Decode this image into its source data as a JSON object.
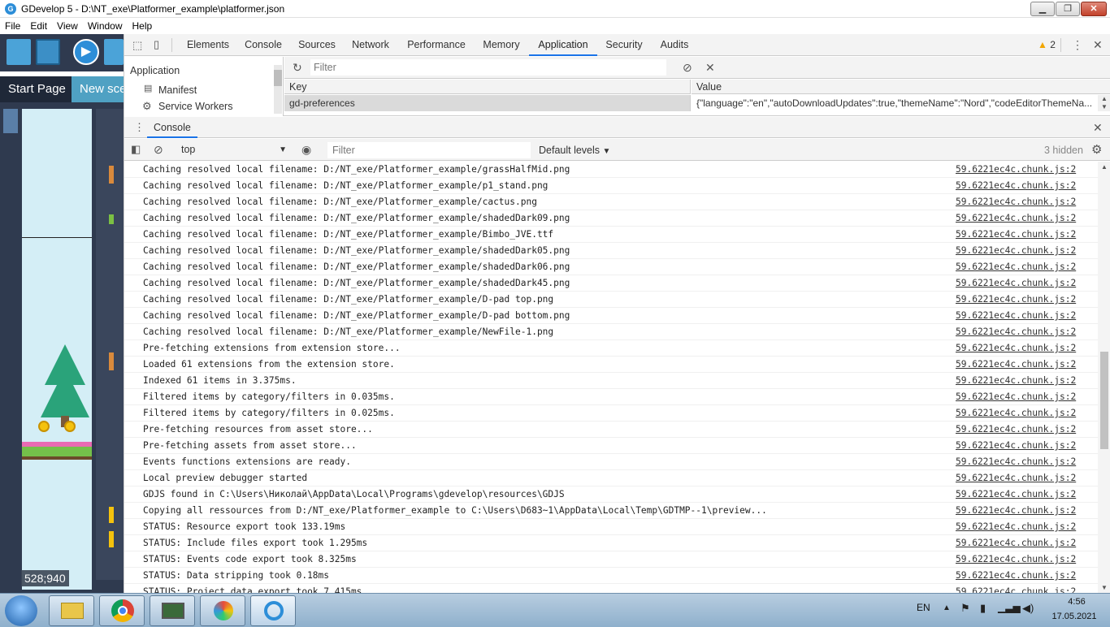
{
  "window": {
    "title": "GDevelop 5 - D:\\NT_exe\\Platformer_example\\platformer.json",
    "icon": "gdevelop-logo-icon"
  },
  "menu": [
    "File",
    "Edit",
    "View",
    "Window",
    "Help"
  ],
  "gdevelop": {
    "tabs": {
      "start": "Start Page",
      "scene": "New sce"
    },
    "coords": "528;940"
  },
  "devtools": {
    "tabs": [
      "Elements",
      "Console",
      "Sources",
      "Network",
      "Performance",
      "Memory",
      "Application",
      "Security",
      "Audits"
    ],
    "active_tab": "Application",
    "warning_count": "2",
    "application": {
      "section": "Application",
      "items": [
        "Manifest",
        "Service Workers"
      ],
      "filter_placeholder": "Filter",
      "columns": {
        "key": "Key",
        "value": "Value"
      },
      "row": {
        "key": "gd-preferences",
        "value": "{\"language\":\"en\",\"autoDownloadUpdates\":true,\"themeName\":\"Nord\",\"codeEditorThemeNa..."
      }
    },
    "console": {
      "tab": "Console",
      "context": "top",
      "filter_placeholder": "Filter",
      "levels": "Default levels",
      "hidden": "3 hidden",
      "source": "59.6221ec4c.chunk.js:2",
      "lines": [
        "Caching resolved local filename: D:/NT_exe/Platformer_example/grassHalfMid.png",
        "Caching resolved local filename: D:/NT_exe/Platformer_example/p1_stand.png",
        "Caching resolved local filename: D:/NT_exe/Platformer_example/cactus.png",
        "Caching resolved local filename: D:/NT_exe/Platformer_example/shadedDark09.png",
        "Caching resolved local filename: D:/NT_exe/Platformer_example/Bimbo_JVE.ttf",
        "Caching resolved local filename: D:/NT_exe/Platformer_example/shadedDark05.png",
        "Caching resolved local filename: D:/NT_exe/Platformer_example/shadedDark06.png",
        "Caching resolved local filename: D:/NT_exe/Platformer_example/shadedDark45.png",
        "Caching resolved local filename: D:/NT_exe/Platformer_example/D-pad top.png",
        "Caching resolved local filename: D:/NT_exe/Platformer_example/D-pad bottom.png",
        "Caching resolved local filename: D:/NT_exe/Platformer_example/NewFile-1.png",
        "Pre-fetching extensions from extension store...",
        "Loaded 61 extensions from the extension store.",
        "Indexed 61 items in 3.375ms.",
        "Filtered items by category/filters in 0.035ms.",
        "Filtered items by category/filters in 0.025ms.",
        "Pre-fetching resources from asset store...",
        "Pre-fetching assets from asset store...",
        "Events functions extensions are ready.",
        "Local preview debugger started",
        "GDJS found in  C:\\Users\\Николай\\AppData\\Local\\Programs\\gdevelop\\resources\\GDJS",
        "Copying all ressources from D:/NT_exe/Platformer_example to C:\\Users\\D683~1\\AppData\\Local\\Temp\\GDTMP--1\\preview...",
        "STATUS: Resource export took 133.19ms",
        "STATUS: Include files export took 1.295ms",
        "STATUS: Events code export took 8.325ms",
        "STATUS: Data stripping took 0.18ms",
        "STATUS: Project data export took 7.415ms"
      ]
    }
  },
  "taskbar": {
    "apps": [
      "file-explorer-icon",
      "chrome-icon",
      "system-monitor-icon",
      "paint-icon",
      "gdevelop-icon"
    ],
    "lang": "EN",
    "time": "4:56",
    "date": "17.05.2021"
  }
}
